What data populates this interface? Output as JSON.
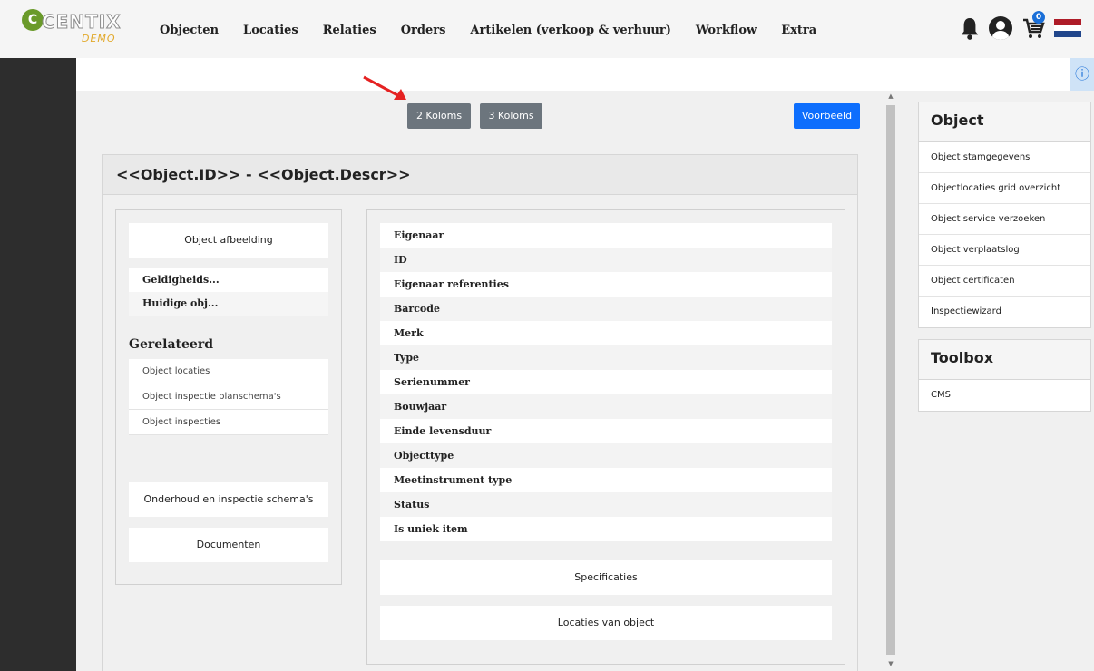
{
  "header": {
    "logo_text": "CENTIX",
    "logo_sub": "DEMO",
    "nav": [
      "Objecten",
      "Locaties",
      "Relaties",
      "Orders",
      "Artikelen (verkoop & verhuur)",
      "Workflow",
      "Extra"
    ],
    "cart_count": "0"
  },
  "toolbar": {
    "two_cols": "2 Koloms",
    "three_cols": "3 Koloms",
    "preview": "Voorbeeld"
  },
  "info_icon": "ⓘ",
  "card": {
    "title": "<<Object.ID>> - <<Object.Descr>>",
    "image_label": "Object afbeelding",
    "small_fields": [
      "Geldigheids...",
      "Huidige obj..."
    ],
    "related_title": "Gerelateerd",
    "related_items": [
      "Object locaties",
      "Object inspectie planschema's",
      "Object inspecties"
    ],
    "maintenance_label": "Onderhoud en inspectie schema's",
    "documents_label": "Documenten",
    "fields": [
      "Eigenaar",
      "ID",
      "Eigenaar referenties",
      "Barcode",
      "Merk",
      "Type",
      "Serienummer",
      "Bouwjaar",
      "Einde levensduur",
      "Objecttype",
      "Meetinstrument type",
      "Status",
      "Is uniek item"
    ],
    "specs_label": "Specificaties",
    "locations_label": "Locaties van object"
  },
  "right_panel": {
    "object_title": "Object",
    "object_items": [
      "Object stamgegevens",
      "Objectlocaties grid overzicht",
      "Object service verzoeken",
      "Object verplaatslog",
      "Object certificaten",
      "Inspectiewizard"
    ],
    "toolbox_title": "Toolbox",
    "toolbox_items": [
      "CMS"
    ]
  },
  "colors": {
    "primary": "#0d6efd",
    "secondary": "#6c757d",
    "sidebar": "#2d2d2d"
  }
}
